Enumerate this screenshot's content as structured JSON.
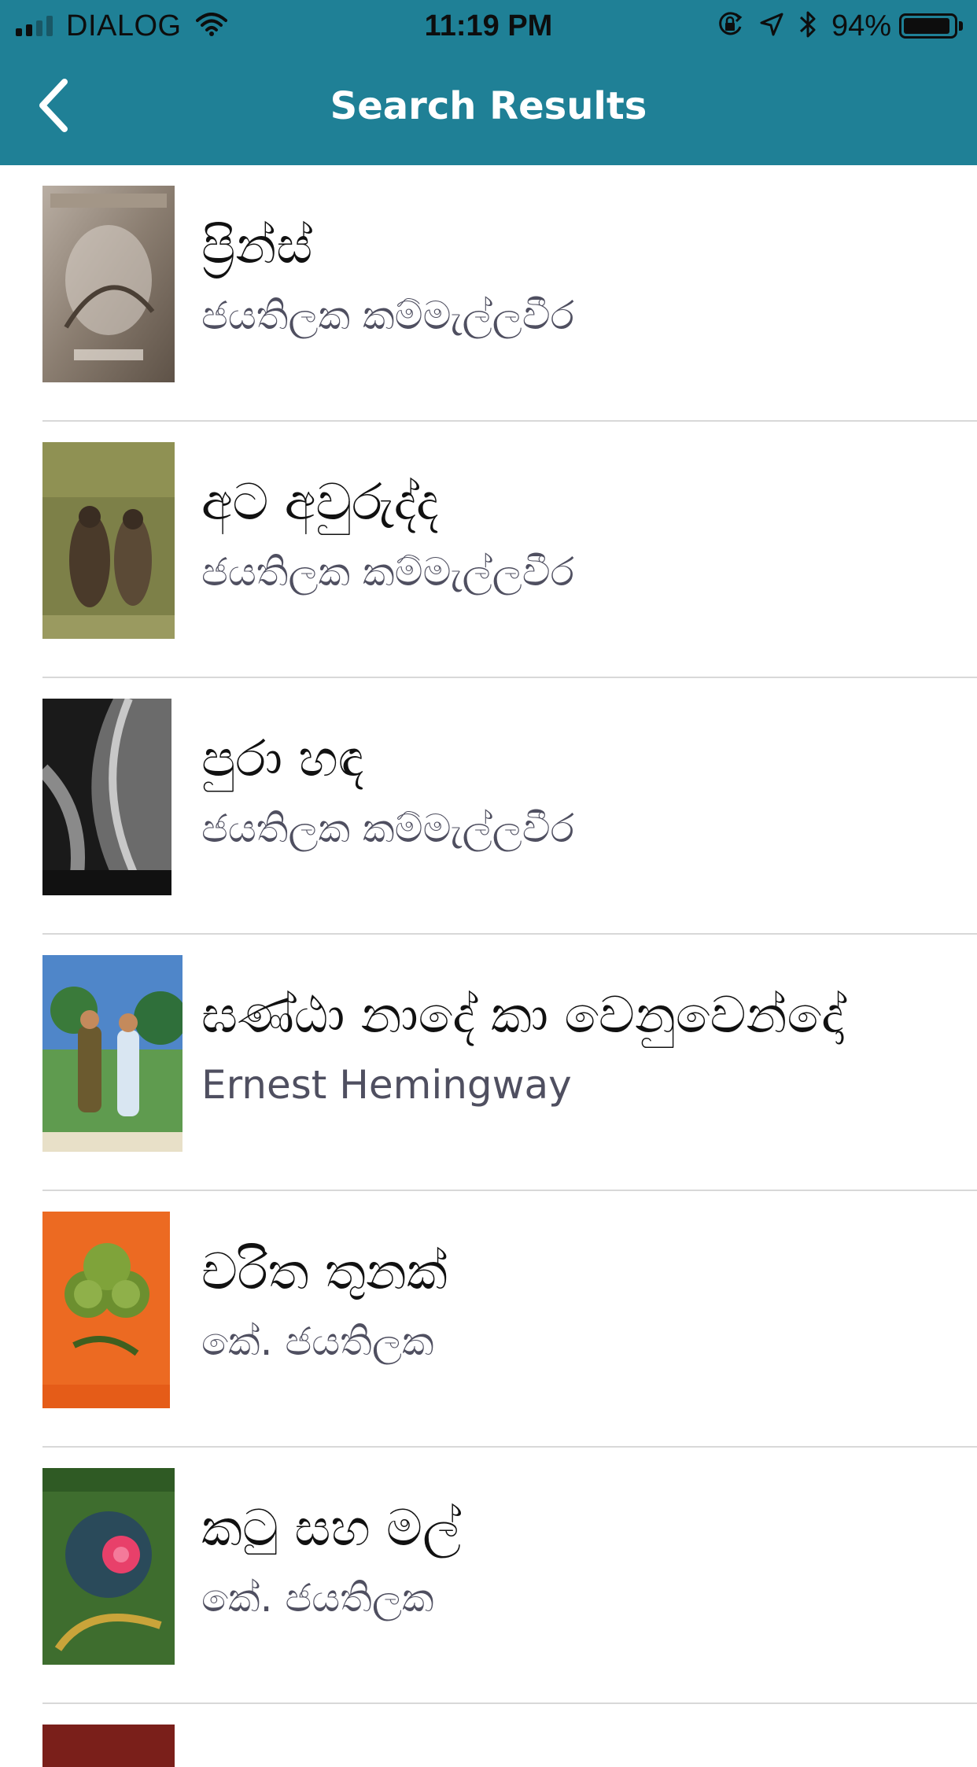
{
  "status_bar": {
    "carrier": "DIALOG",
    "time": "11:19 PM",
    "battery_percent": "94%",
    "battery_level": 0.94,
    "icons": [
      "signal-icon",
      "wifi-icon",
      "orientation-lock-icon",
      "location-arrow-icon",
      "bluetooth-icon",
      "battery-icon"
    ]
  },
  "nav": {
    "title": "Search Results",
    "back_icon": "chevron-left-icon"
  },
  "colors": {
    "header": "#1f8096",
    "title_text": "#111111",
    "author_text": "#4f4f60",
    "divider": "#d8d8d8"
  },
  "results": [
    {
      "title": "ප්‍රින්ස්",
      "author": "ජයතිලක කම්මැල්ලවීර"
    },
    {
      "title": "අට අවුරුද්ද",
      "author": "ජයතිලක කම්මැල්ලවීර"
    },
    {
      "title": "පුරා හඳ",
      "author": "ජයතිලක කම්මැල්ලවීර"
    },
    {
      "title": "ඝණ්ඨා නාදේ කා වෙනුවෙන්දෝ",
      "author": "Ernest Hemingway"
    },
    {
      "title": "චරිත තුනක්",
      "author": "කේ. ජයතිලක"
    },
    {
      "title": "කටු සහ මල්",
      "author": "කේ. ජයතිලක"
    }
  ]
}
